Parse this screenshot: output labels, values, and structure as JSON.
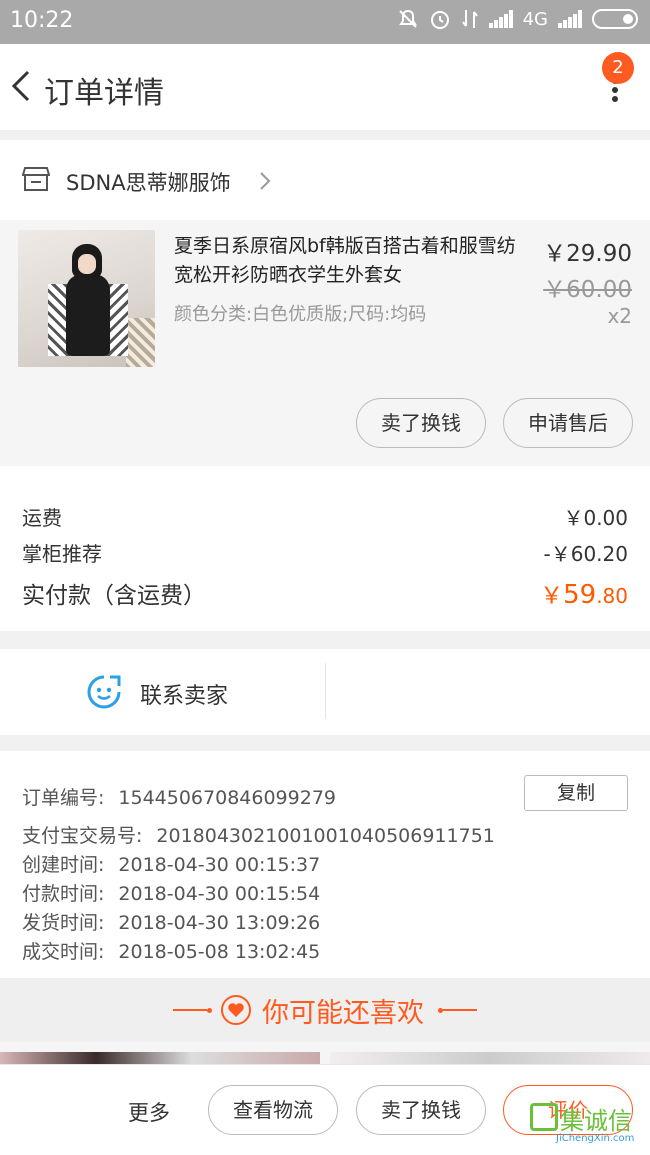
{
  "status_bar": {
    "time": "10:22",
    "network": "4G"
  },
  "header": {
    "title": "订单详情",
    "badge_count": "2"
  },
  "shop": {
    "name": "SDNA思蒂娜服饰"
  },
  "item": {
    "name": "夏季日系原宿风bf韩版百搭古着和服雪纺宽松开衫防晒衣学生外套女",
    "spec": "颜色分类:白色优质版;尺码:均码",
    "price": "￥29.90",
    "original_price": "￥60.00",
    "quantity": "x2",
    "buttons": [
      "卖了换钱",
      "申请售后"
    ]
  },
  "fees": {
    "shipping_label": "运费",
    "shipping_value": "￥0.00",
    "discount_label": "掌柜推荐",
    "discount_value": "-￥60.20",
    "paid_label": "实付款（含运费）",
    "paid_currency": "￥",
    "paid_int": "59",
    "paid_dec": ".80"
  },
  "contact": {
    "label": "联系卖家"
  },
  "order_info": {
    "copy_label": "复制",
    "rows": [
      {
        "key": "订单编号:",
        "value": "154450670846099279"
      },
      {
        "key": "支付宝交易号:",
        "value": "2018043021001001040506911751"
      },
      {
        "key": "创建时间:",
        "value": "2018-04-30 00:15:37"
      },
      {
        "key": "付款时间:",
        "value": "2018-04-30 00:15:54"
      },
      {
        "key": "发货时间:",
        "value": "2018-04-30 13:09:26"
      },
      {
        "key": "成交时间:",
        "value": "2018-05-08 13:02:45"
      }
    ]
  },
  "recommend": {
    "title": "你可能还喜欢"
  },
  "bottom_bar": {
    "more": "更多",
    "track": "查看物流",
    "sell": "卖了换钱",
    "review": "评价"
  },
  "watermark": {
    "main": "集诚信",
    "sub": "JiChengXin.com"
  },
  "colors": {
    "accent": "#ff5a1f",
    "price_orange": "#ff5a00",
    "status_bar": "#a9a9a9"
  },
  "icons": [
    "mute-icon",
    "alarm-icon",
    "data-icon",
    "signal-icon",
    "battery-icon",
    "back-arrow-icon",
    "more-dots-icon",
    "store-icon",
    "chevron-right-icon",
    "chat-face-icon",
    "heart-icon"
  ]
}
